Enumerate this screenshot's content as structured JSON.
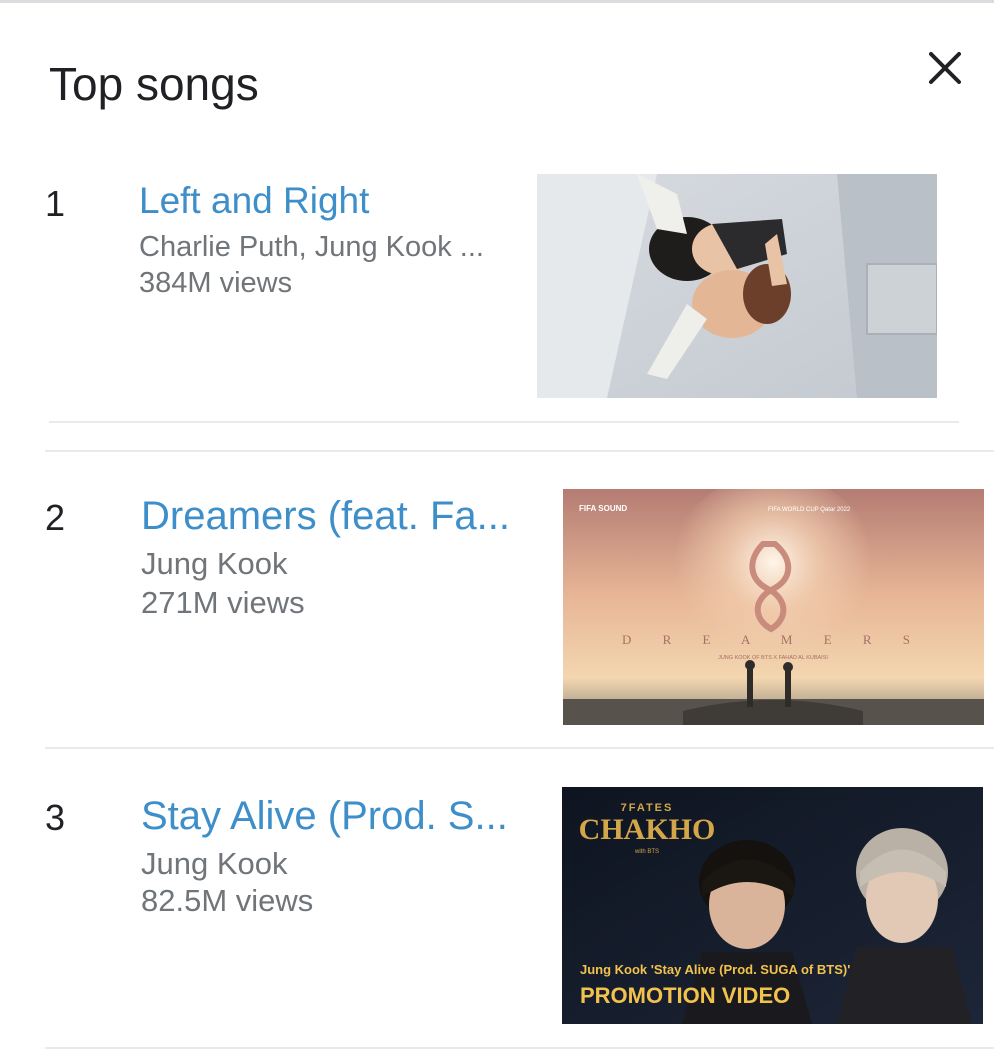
{
  "header": {
    "title": "Top songs",
    "close_icon": "close-icon"
  },
  "songs": [
    {
      "rank": "1",
      "title": "Left and Right",
      "artist": "Charlie Puth, Jung Kook ...",
      "views": "384M views",
      "thumbnail_icon": "video-thumbnail"
    },
    {
      "rank": "2",
      "title": "Dreamers (feat. Fa...",
      "artist": "Jung Kook",
      "views": "271M views",
      "thumbnail_icon": "video-thumbnail",
      "thumbnail_text": {
        "badge": "FIFA SOUND",
        "event": "FIFA WORLD CUP Qatar 2022",
        "word": "D R E A M E R S",
        "credit": "JUNG KOOK OF BTS X FAHAD AL KUBAISI"
      }
    },
    {
      "rank": "3",
      "title": "Stay Alive (Prod. S...",
      "artist": "Jung Kook",
      "views": "82.5M views",
      "thumbnail_icon": "video-thumbnail",
      "thumbnail_text": {
        "top": "7FATES",
        "logo": "CHAKHO",
        "with": "with BTS",
        "caption": "Jung Kook 'Stay Alive (Prod. SUGA of BTS)'",
        "promo": "PROMOTION VIDEO"
      }
    }
  ],
  "colors": {
    "title_link": "#3d8ec9",
    "secondary_text": "#70757a",
    "divider": "#e8eaed"
  }
}
